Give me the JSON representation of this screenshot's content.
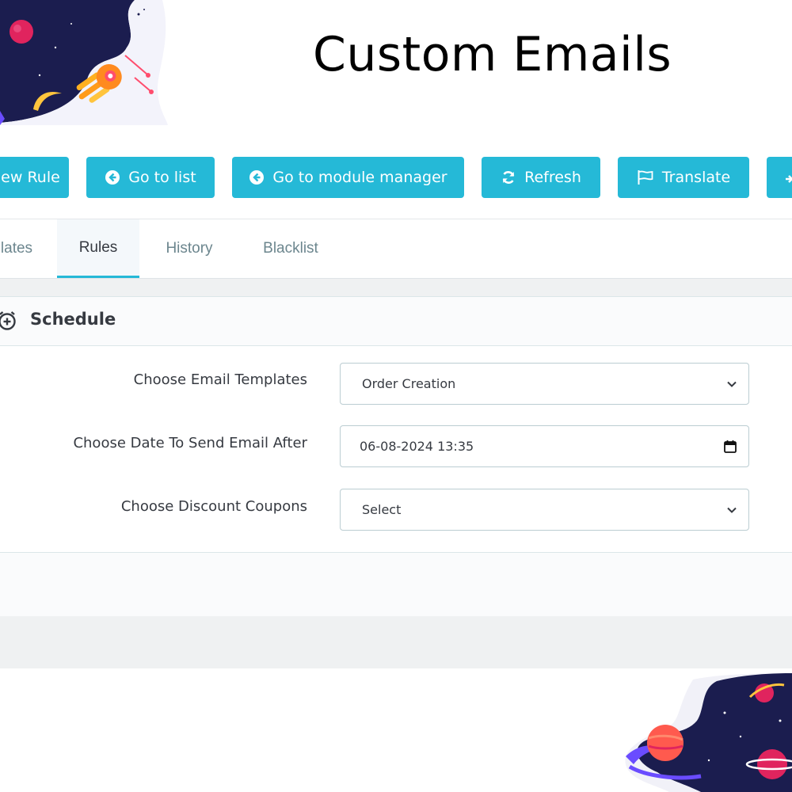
{
  "page": {
    "title": "Custom Emails"
  },
  "toolbar": {
    "new_rule": "ew Rule",
    "go_to_list": "Go to list",
    "go_to_module_manager": "Go to module manager",
    "refresh": "Refresh",
    "translate": "Translate",
    "colors": {
      "button_bg": "#25b9d7",
      "button_text": "#ffffff"
    }
  },
  "tabs": [
    {
      "label": "lates",
      "active": false
    },
    {
      "label": "Rules",
      "active": true
    },
    {
      "label": "History",
      "active": false
    },
    {
      "label": "Blacklist",
      "active": false
    }
  ],
  "panel": {
    "title": "Schedule",
    "icon": "alarm-clock-plus-icon",
    "fields": [
      {
        "label": "Choose Email Templates",
        "type": "select",
        "value": "Order Creation"
      },
      {
        "label": "Choose Date To Send Email After",
        "type": "datetime",
        "value": "06-08-2024 13:35"
      },
      {
        "label": "Choose Discount Coupons",
        "type": "select",
        "value": "Select"
      }
    ]
  }
}
